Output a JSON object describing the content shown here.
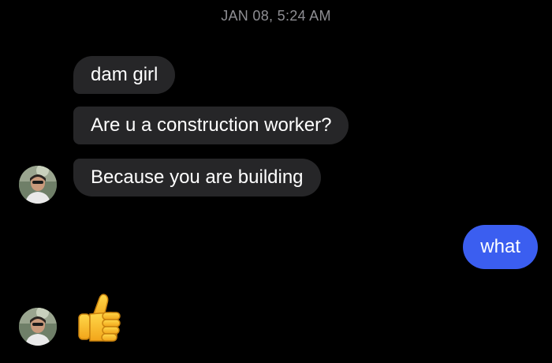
{
  "conversation": {
    "timestamp": "JAN 08, 5:24 AM",
    "incoming_messages": [
      {
        "text": "dam girl"
      },
      {
        "text": "Are u a construction worker?"
      },
      {
        "text": "Because you are building"
      }
    ],
    "outgoing_message": {
      "text": "what"
    },
    "reaction": {
      "type": "thumbs-up-emoji"
    }
  },
  "colors": {
    "background": "#000000",
    "incoming_bubble": "#262628",
    "outgoing_bubble": "#3b5ef0",
    "timestamp_text": "#8e8e93"
  }
}
